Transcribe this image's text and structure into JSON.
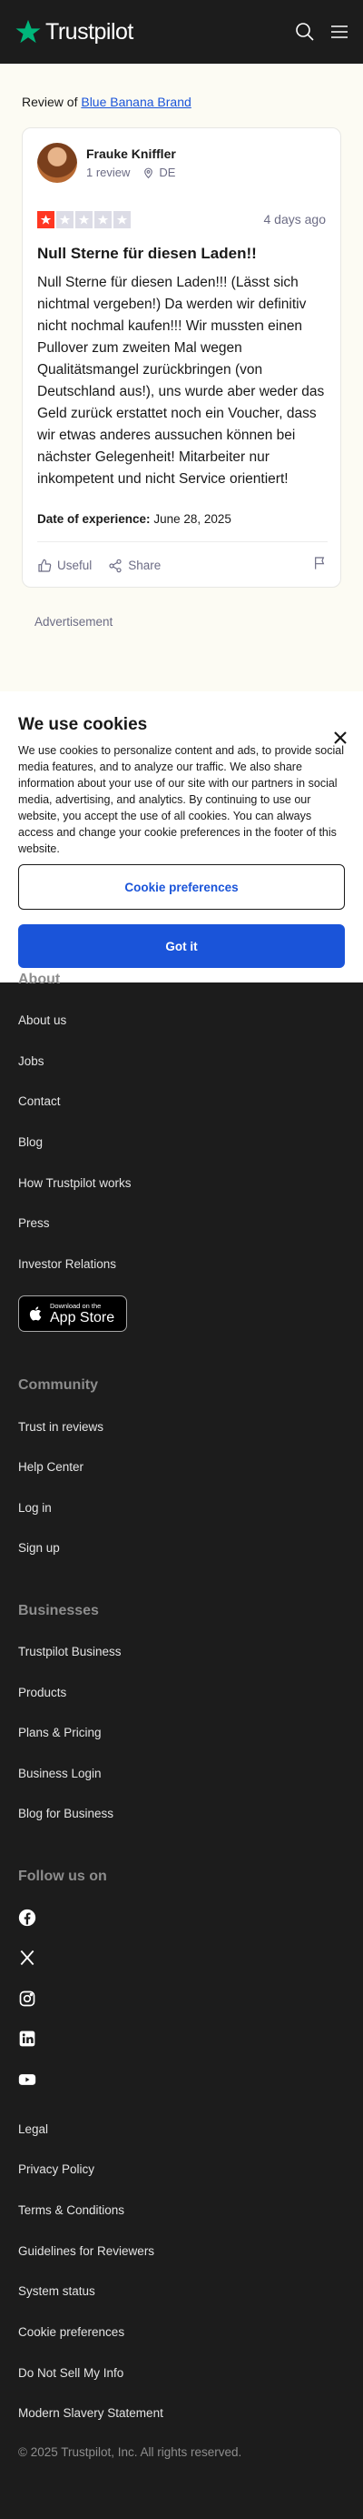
{
  "header": {
    "logo_text": "Trustpilot",
    "brand_color": "#00b67a",
    "icons": [
      "search-icon",
      "menu-icon"
    ]
  },
  "review": {
    "review_of_prefix": "Review of",
    "company_link": "Blue Banana Brand",
    "reviewer_name": "Frauke Kniffler",
    "reviewer_review_count": "1 review",
    "reviewer_country": "DE",
    "rating": 1,
    "rating_max": 5,
    "date": "4 days ago",
    "title": "Null Sterne für diesen Laden!!",
    "body": "Null Sterne für diesen Laden!!! (Lässt sich nichtmal vergeben!) Da werden wir definitiv nicht nochmal kaufen!!! Wir mussten einen Pullover zum zweiten Mal wegen Qualitätsmangel zurückbringen (von Deutschland aus!), uns wurde aber weder das Geld zurück erstattet noch ein Voucher, dass wir etwas anderes aussuchen können bei nächster Gelegenheit! Mitarbeiter nur inkompetent und nicht Service orientiert!",
    "experience_label": "Date of experience:",
    "experience_date": "June 28, 2025",
    "useful_label": "Useful",
    "share_label": "Share",
    "star_color": "#ff3722"
  },
  "advertisement_label": "Advertisement",
  "cookie_banner": {
    "title": "We use cookies",
    "text": "We use cookies to personalize content and ads, to provide social media features, and to analyze our traffic. We also share information about your use of our site with our partners in social media, advertising, and analytics. By continuing to use our website, you accept the use of all cookies. You can always access and change your cookie preferences in the footer of this website.",
    "preferences_button": "Cookie preferences",
    "accept_button": "Got it",
    "accent_color": "#1a54d9"
  },
  "footer": {
    "about": {
      "heading": "About",
      "links": [
        "About us",
        "Jobs",
        "Contact",
        "Blog",
        "How Trustpilot works",
        "Press",
        "Investor Relations"
      ]
    },
    "app_store": {
      "small": "Download on the",
      "big": "App Store"
    },
    "community": {
      "heading": "Community",
      "links": [
        "Trust in reviews",
        "Help Center",
        "Log in",
        "Sign up"
      ]
    },
    "businesses": {
      "heading": "Businesses",
      "links": [
        "Trustpilot Business",
        "Products",
        "Plans & Pricing",
        "Business Login",
        "Blog for Business"
      ]
    },
    "follow": {
      "heading": "Follow us on",
      "icons": [
        "facebook-icon",
        "x-icon",
        "instagram-icon",
        "linkedin-icon",
        "youtube-icon"
      ]
    },
    "legal_links": [
      "Legal",
      "Privacy Policy",
      "Terms & Conditions",
      "Guidelines for Reviewers",
      "System status",
      "Cookie preferences",
      "Do Not Sell My Info",
      "Modern Slavery Statement"
    ],
    "copyright": "© 2025 Trustpilot, Inc. All rights reserved."
  }
}
